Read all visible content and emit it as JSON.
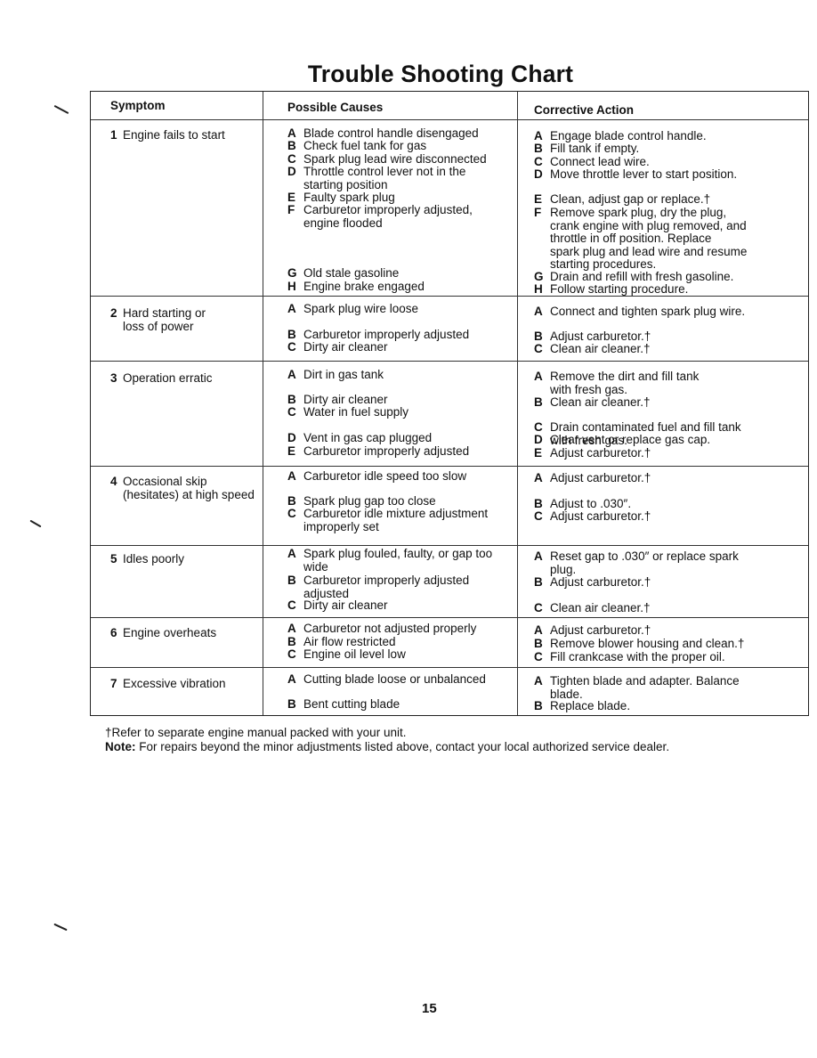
{
  "title": "Trouble Shooting Chart",
  "headers": {
    "symptom": "Symptom",
    "causes": "Possible Causes",
    "action": "Corrective Action"
  },
  "rows": [
    {
      "number": "1",
      "symptom": [
        "Engine fails to start"
      ],
      "causes": [
        {
          "letter": "A",
          "text": "Blade control handle disengaged"
        },
        {
          "letter": "B",
          "text": "Check fuel tank for gas"
        },
        {
          "letter": "C",
          "text": "Spark plug lead wire disconnected"
        },
        {
          "letter": "D",
          "text": "Throttle control lever not in the\nstarting position"
        },
        {
          "letter": "E",
          "text": "Faulty spark plug"
        },
        {
          "letter": "F",
          "text": "Carburetor improperly adjusted,\nengine flooded"
        },
        {
          "letter": "G",
          "text": "Old stale gasoline"
        },
        {
          "letter": "H",
          "text": "Engine brake engaged"
        }
      ],
      "actions": [
        {
          "letter": "A",
          "text": "Engage blade control handle."
        },
        {
          "letter": "B",
          "text": "Fill tank if empty."
        },
        {
          "letter": "C",
          "text": "Connect lead wire."
        },
        {
          "letter": "D",
          "text": "Move throttle lever to start position."
        },
        {
          "letter": "E",
          "text": "Clean, adjust gap or replace.†"
        },
        {
          "letter": "F",
          "text": "Remove spark plug, dry the plug,\ncrank engine with plug removed, and\nthrottle in off position. Replace\nspark plug and lead wire and resume\nstarting procedures."
        },
        {
          "letter": "G",
          "text": "Drain and refill with fresh gasoline."
        },
        {
          "letter": "H",
          "text": "Follow starting procedure."
        }
      ]
    },
    {
      "number": "2",
      "symptom": [
        "Hard starting or",
        "loss of power"
      ],
      "causes": [
        {
          "letter": "A",
          "text": "Spark plug wire loose"
        },
        {
          "letter": "B",
          "text": "Carburetor improperly adjusted"
        },
        {
          "letter": "C",
          "text": "Dirty air cleaner"
        }
      ],
      "actions": [
        {
          "letter": "A",
          "text": "Connect and tighten spark plug wire."
        },
        {
          "letter": "B",
          "text": "Adjust carburetor.†"
        },
        {
          "letter": "C",
          "text": "Clean air cleaner.†"
        }
      ]
    },
    {
      "number": "3",
      "symptom": [
        "Operation erratic"
      ],
      "causes": [
        {
          "letter": "A",
          "text": "Dirt in gas tank"
        },
        {
          "letter": "B",
          "text": "Dirty air cleaner"
        },
        {
          "letter": "C",
          "text": "Water in fuel supply"
        },
        {
          "letter": "D",
          "text": "Vent in gas cap plugged"
        },
        {
          "letter": "E",
          "text": "Carburetor improperly adjusted"
        }
      ],
      "actions": [
        {
          "letter": "A",
          "text": "Remove the dirt and fill tank\nwith fresh gas."
        },
        {
          "letter": "B",
          "text": "Clean air cleaner.†"
        },
        {
          "letter": "C",
          "text": "Drain contaminated fuel and fill tank\nwith fresh gas."
        },
        {
          "letter": "D",
          "text": "Clear vent or replace gas cap."
        },
        {
          "letter": "E",
          "text": "Adjust carburetor.†"
        }
      ]
    },
    {
      "number": "4",
      "symptom": [
        "Occasional skip",
        "(hesitates) at high speed"
      ],
      "causes": [
        {
          "letter": "A",
          "text": "Carburetor idle speed too slow"
        },
        {
          "letter": "B",
          "text": "Spark plug gap too close"
        },
        {
          "letter": "C",
          "text": "Carburetor idle mixture adjustment\nimproperly set"
        }
      ],
      "actions": [
        {
          "letter": "A",
          "text": "Adjust carburetor.†"
        },
        {
          "letter": "B",
          "text": "Adjust to .030″."
        },
        {
          "letter": "C",
          "text": "Adjust carburetor.†"
        }
      ]
    },
    {
      "number": "5",
      "symptom": [
        "Idles poorly"
      ],
      "causes": [
        {
          "letter": "A",
          "text": "Spark plug fouled, faulty, or gap too\nwide"
        },
        {
          "letter": "B",
          "text": "Carburetor improperly adjusted\nadjusted"
        },
        {
          "letter": "C",
          "text": "Dirty air cleaner"
        }
      ],
      "actions": [
        {
          "letter": "A",
          "text": "Reset gap to .030″ or replace spark\nplug."
        },
        {
          "letter": "B",
          "text": "Adjust carburetor.†"
        },
        {
          "letter": "C",
          "text": "Clean air cleaner.†"
        }
      ]
    },
    {
      "number": "6",
      "symptom": [
        "Engine overheats"
      ],
      "causes": [
        {
          "letter": "A",
          "text": "Carburetor not adjusted properly"
        },
        {
          "letter": "B",
          "text": "Air flow restricted"
        },
        {
          "letter": "C",
          "text": "Engine oil level low"
        }
      ],
      "actions": [
        {
          "letter": "A",
          "text": "Adjust carburetor.†"
        },
        {
          "letter": "B",
          "text": "Remove blower housing and clean.†"
        },
        {
          "letter": "C",
          "text": "Fill crankcase with the proper oil."
        }
      ]
    },
    {
      "number": "7",
      "symptom": [
        "Excessive vibration"
      ],
      "causes": [
        {
          "letter": "A",
          "text": "Cutting blade loose or unbalanced"
        },
        {
          "letter": "B",
          "text": "Bent cutting blade"
        }
      ],
      "actions": [
        {
          "letter": "A",
          "text": "Tighten blade and adapter. Balance\nblade."
        },
        {
          "letter": "B",
          "text": "Replace blade."
        }
      ]
    }
  ],
  "footnote": {
    "dagger_note": "†Refer to separate engine manual packed with your unit.",
    "note_label": "Note:",
    "note_text": " For repairs beyond the minor adjustments listed above, contact your local authorized service dealer."
  },
  "page_number": "15"
}
